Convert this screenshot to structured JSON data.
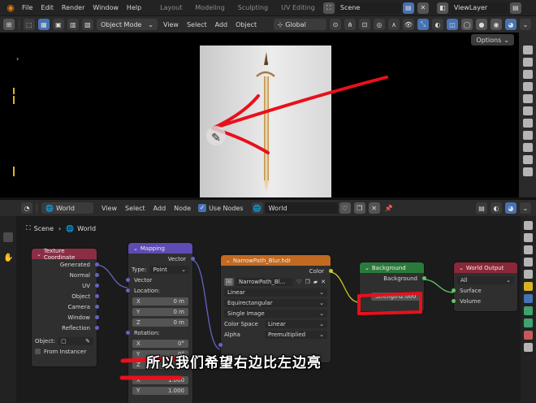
{
  "topbar": {
    "menus": [
      "File",
      "Edit",
      "Render",
      "Window",
      "Help"
    ],
    "workspaces": [
      "Layout",
      "Modeling",
      "Sculpting",
      "UV Editing"
    ],
    "scene": "Scene",
    "view_layer": "ViewLayer"
  },
  "viewport_header": {
    "mode": "Object Mode",
    "menus": [
      "View",
      "Select",
      "Add",
      "Object"
    ],
    "orientation": "Global",
    "options": "Options"
  },
  "node_header": {
    "world_type": "World",
    "menus": [
      "View",
      "Select",
      "Add",
      "Node"
    ],
    "use_nodes": "Use Nodes",
    "world_name": "World"
  },
  "breadcrumb": {
    "scene": "Scene",
    "world": "World"
  },
  "nodes": {
    "texcoord": {
      "title": "Texture Coordinate",
      "outputs": [
        "Generated",
        "Normal",
        "UV",
        "Object",
        "Camera",
        "Window",
        "Reflection"
      ],
      "object_label": "Object:",
      "from_instancer": "From Instancer"
    },
    "mapping": {
      "title": "Mapping",
      "output": "Vector",
      "type_label": "Type:",
      "type_value": "Point",
      "vector_in": "Vector",
      "location": "Location:",
      "loc": [
        {
          "axis": "X",
          "value": "0 m"
        },
        {
          "axis": "Y",
          "value": "0 m"
        },
        {
          "axis": "Z",
          "value": "0 m"
        }
      ],
      "rotation": "Rotation:",
      "rot": [
        {
          "axis": "X",
          "value": "0°"
        },
        {
          "axis": "Y",
          "value": "0°"
        },
        {
          "axis": "Z",
          "value": "0°"
        }
      ],
      "scale": [
        {
          "axis": "X",
          "value": "1.000"
        },
        {
          "axis": "Y",
          "value": "1.000"
        }
      ]
    },
    "envtex": {
      "title": "NarrowPath_Blur.hdr",
      "output": "Color",
      "image": "NarrowPath_Bl...",
      "interpolation": "Linear",
      "projection": "Equirectangular",
      "source": "Single Image",
      "color_space_label": "Color Space",
      "color_space": "Linear",
      "alpha_label": "Alpha",
      "alpha": "Premultiplied"
    },
    "background": {
      "title": "Background",
      "output": "Background",
      "strength_label": "Strength",
      "strength": "2.000"
    },
    "world_output": {
      "title": "World Output",
      "target": "All",
      "surface": "Surface",
      "volume": "Volume"
    }
  },
  "subtitle": "所以我们希望右边比左边亮",
  "colors": {
    "annotation": "#e8101c",
    "node_purple": "#5e4bb3",
    "node_texture": "#c26a21",
    "node_shader": "#2b7a3b",
    "node_output": "#8a2738",
    "node_input": "#8b2e45",
    "accent": "#4772b3"
  }
}
